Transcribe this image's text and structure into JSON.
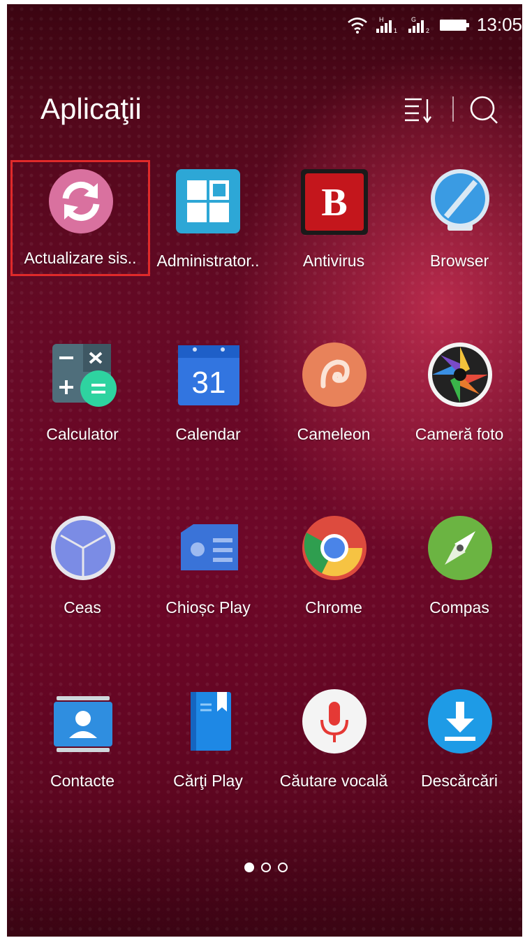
{
  "status_bar": {
    "time": "13:05",
    "sim1_tech": "H",
    "sim1_slot": "1",
    "sim2_tech": "G",
    "sim2_slot": "2"
  },
  "header": {
    "title": "Aplicaţii"
  },
  "apps": [
    {
      "label": "Actualizare sis..",
      "icon": "sync-icon",
      "selected": true
    },
    {
      "label": "Administrator..",
      "icon": "windows-grid-icon"
    },
    {
      "label": "Antivirus",
      "icon": "bitdefender-b-icon"
    },
    {
      "label": "Browser",
      "icon": "globe-icon"
    },
    {
      "label": "Calculator",
      "icon": "calculator-icon"
    },
    {
      "label": "Calendar",
      "icon": "calendar-icon",
      "calendar_day": "31"
    },
    {
      "label": "Cameleon",
      "icon": "chameleon-icon"
    },
    {
      "label": "Cameră foto",
      "icon": "camera-aperture-icon"
    },
    {
      "label": "Ceas",
      "icon": "clock-icon"
    },
    {
      "label": "Chioșc Play",
      "icon": "newsstand-icon"
    },
    {
      "label": "Chrome",
      "icon": "chrome-icon"
    },
    {
      "label": "Compas",
      "icon": "compass-icon"
    },
    {
      "label": "Contacte",
      "icon": "contacts-icon"
    },
    {
      "label": "Cărţi Play",
      "icon": "books-icon"
    },
    {
      "label": "Căutare vocală",
      "icon": "microphone-icon"
    },
    {
      "label": "Descărcări",
      "icon": "download-icon"
    }
  ],
  "pagination": {
    "pages": 3,
    "current": 1
  },
  "colors": {
    "selection_outline": "#e02a2a",
    "background": "#640a25"
  }
}
